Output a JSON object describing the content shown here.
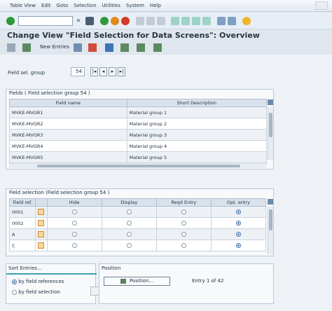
{
  "menu": {
    "items": [
      "Table View",
      "Edit",
      "Goto",
      "Selection",
      "Utilities",
      "System",
      "Help"
    ]
  },
  "toolbar": {
    "command_value": "",
    "icons": [
      "check-icon",
      "save-icon",
      "back-icon",
      "exit-icon",
      "cancel-icon",
      "print-icon",
      "find-icon",
      "find-next-icon",
      "first-page-icon",
      "prev-page-icon",
      "next-page-icon",
      "last-page-icon",
      "new-session-icon",
      "shortcut-icon",
      "help-icon"
    ]
  },
  "title": "Change View \"Field Selection for Data Screens\": Overview",
  "app_toolbar": {
    "new_entries": "New Entries"
  },
  "field_group": {
    "label": "Field sel. group",
    "value": "54"
  },
  "fields_table": {
    "title": "Fields ( Field selection group 54 )",
    "columns": [
      "Field name",
      "Short Description"
    ],
    "rows": [
      [
        "MVKE-MVGR1",
        "Material group 1"
      ],
      [
        "MVKE-MVGR2",
        "Material group 2"
      ],
      [
        "MVKE-MVGR3",
        "Material group 3"
      ],
      [
        "MVKE-MVGR4",
        "Material group 4"
      ],
      [
        "MVKE-MVGR5",
        "Material group 5"
      ]
    ]
  },
  "selection_table": {
    "title": "Field selection (Field selection group 54 )",
    "columns": [
      "Field ref.",
      "Hide",
      "Display",
      "Reqd Entry",
      "Opt. entry"
    ],
    "rows": [
      {
        "ref": "0001",
        "selected": "Opt. entry"
      },
      {
        "ref": "0002",
        "selected": "Opt. entry"
      },
      {
        "ref": "A",
        "selected": "Opt. entry"
      },
      {
        "ref": "C",
        "selected": "Opt. entry"
      }
    ]
  },
  "sort": {
    "title": "Sort Entries...",
    "options": [
      "by field references",
      "by field selection"
    ],
    "selected": 0
  },
  "position": {
    "title": "Position",
    "button": "Position...",
    "entry": "Entry 1 of 42"
  }
}
